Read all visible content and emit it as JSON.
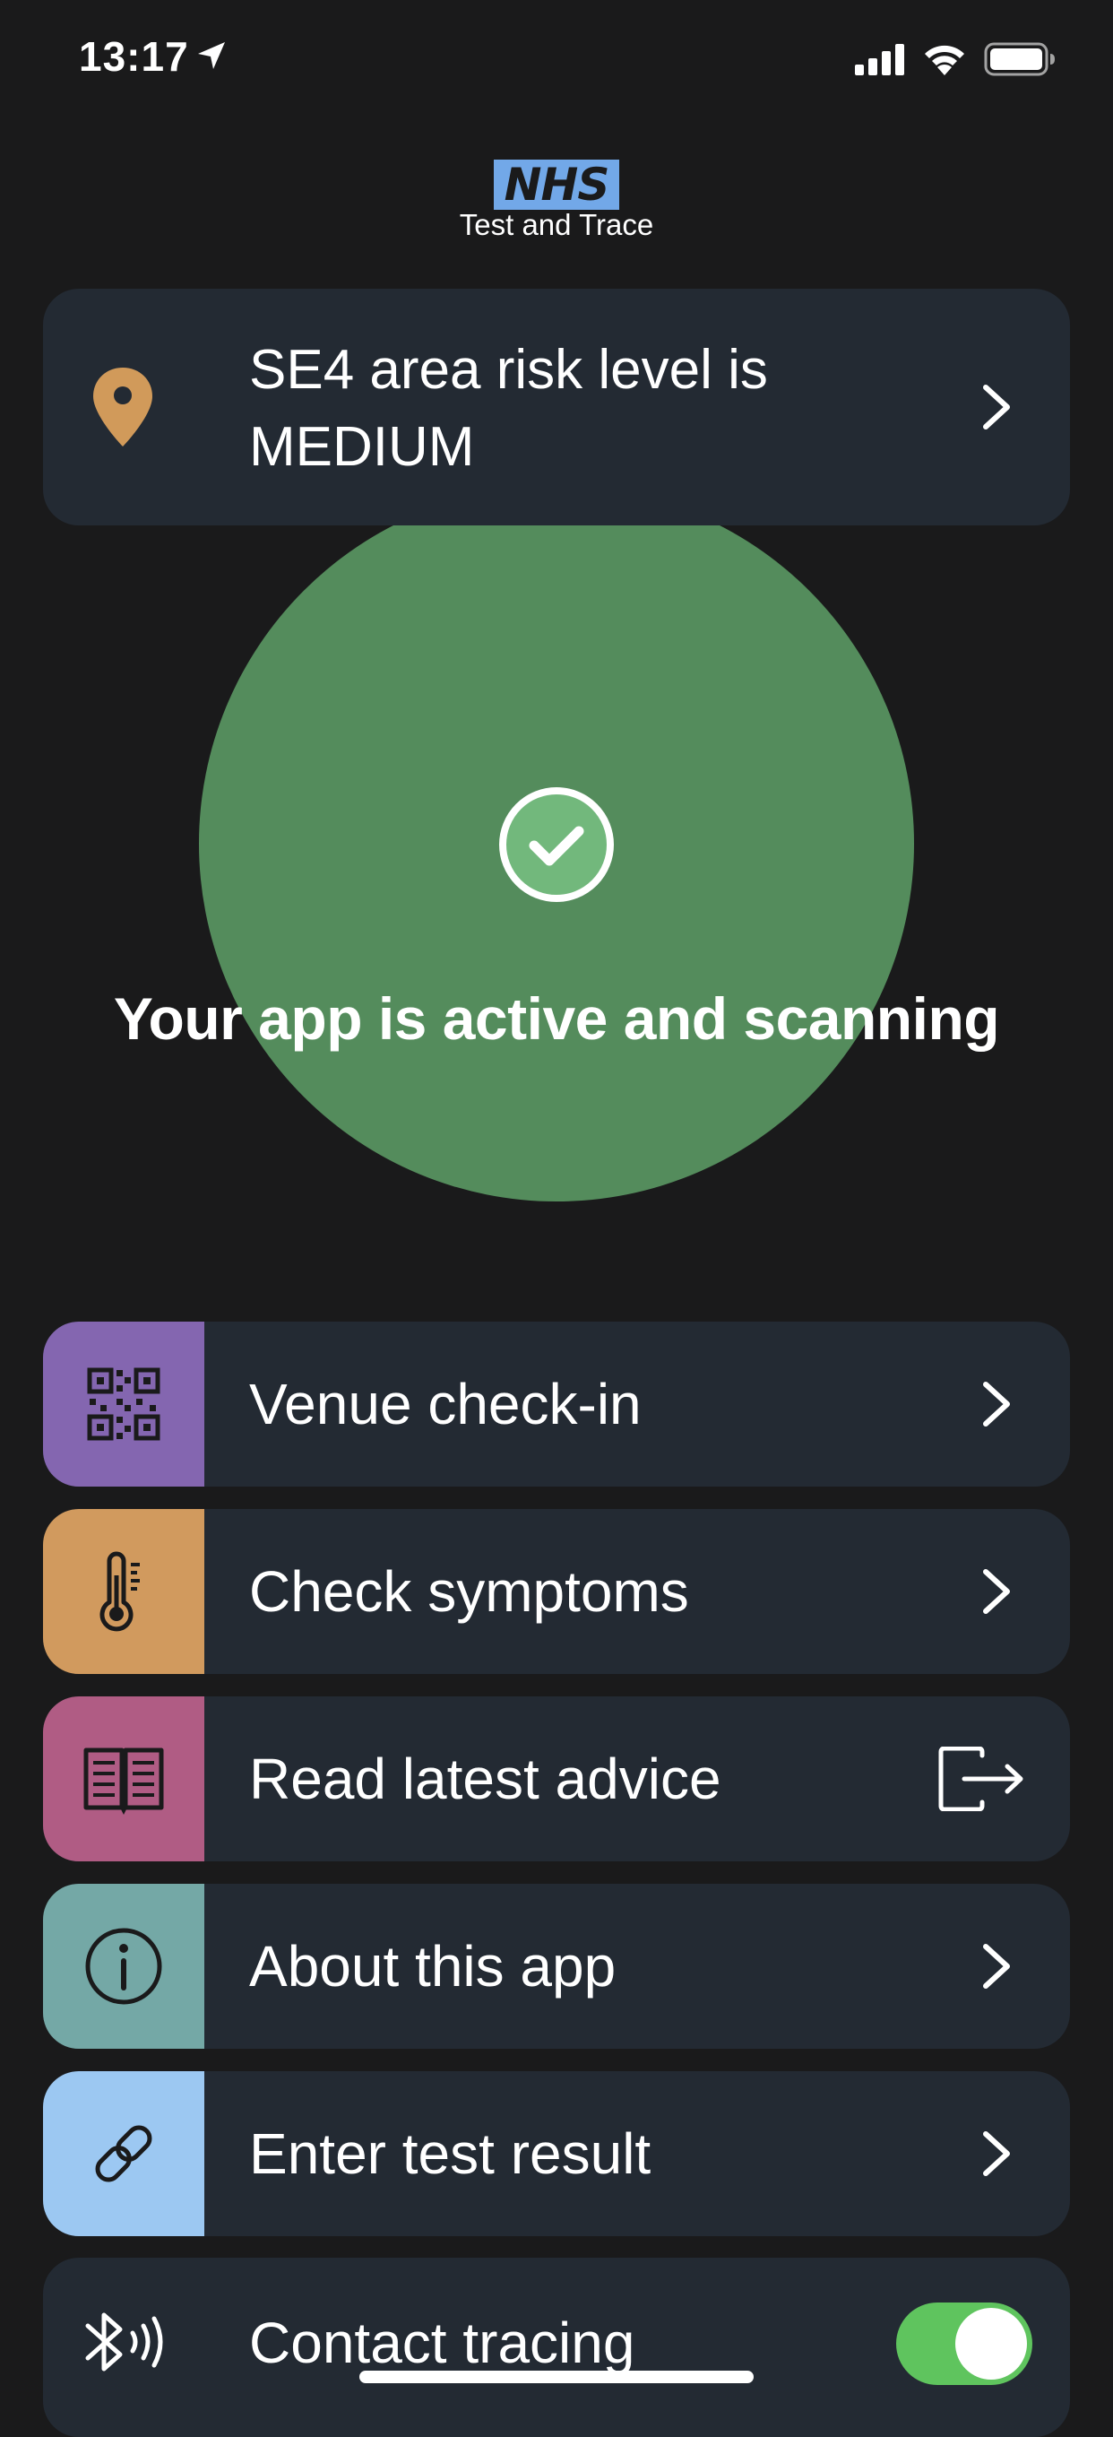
{
  "status_bar": {
    "time": "13:17",
    "icons": [
      "location-arrow-icon",
      "cellular-signal-icon",
      "wifi-icon",
      "battery-icon"
    ]
  },
  "header": {
    "logo_text": "NHS",
    "subtitle": "Test and Trace"
  },
  "risk_card": {
    "text": "SE4 area risk level is MEDIUM",
    "icon": "location-pin-icon",
    "pin_color": "#d19a5a"
  },
  "status": {
    "message": "Your app is active and scanning",
    "icon": "check-circle-icon",
    "circle_color": "#548c5c"
  },
  "menu": {
    "items": [
      {
        "label": "Venue check-in",
        "icon": "qr-code-icon",
        "color": "#8466b0",
        "action_icon": "chevron-right-icon"
      },
      {
        "label": "Check symptoms",
        "icon": "thermometer-icon",
        "color": "#d19a5e",
        "action_icon": "chevron-right-icon"
      },
      {
        "label": "Read latest advice",
        "icon": "book-icon",
        "color": "#b05c84",
        "action_icon": "external-link-icon"
      },
      {
        "label": "About this app",
        "icon": "info-icon",
        "color": "#74a8a6",
        "action_icon": "chevron-right-icon"
      },
      {
        "label": "Enter test result",
        "icon": "link-icon",
        "color": "#9cc8f2",
        "action_icon": "chevron-right-icon"
      }
    ]
  },
  "contact_tracing": {
    "label": "Contact tracing",
    "icon": "bluetooth-icon",
    "enabled": true,
    "toggle_color": "#5fc45e"
  }
}
